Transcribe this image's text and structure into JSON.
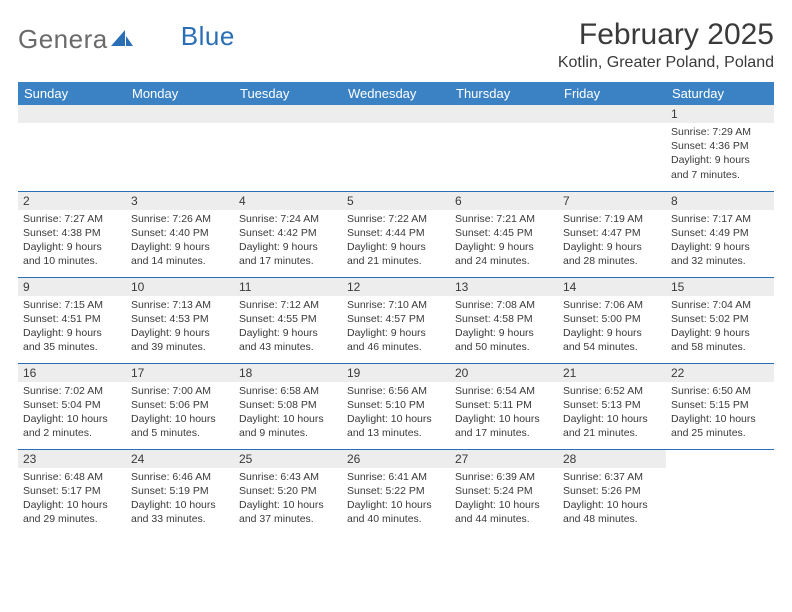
{
  "brand": {
    "part1": "Genera",
    "part2": "Blue"
  },
  "title": "February 2025",
  "location": "Kotlin, Greater Poland, Poland",
  "day_headers": [
    "Sunday",
    "Monday",
    "Tuesday",
    "Wednesday",
    "Thursday",
    "Friday",
    "Saturday"
  ],
  "weeks": [
    [
      null,
      null,
      null,
      null,
      null,
      null,
      {
        "n": "1",
        "sunrise": "7:29 AM",
        "sunset": "4:36 PM",
        "daylight": "9 hours and 7 minutes."
      }
    ],
    [
      {
        "n": "2",
        "sunrise": "7:27 AM",
        "sunset": "4:38 PM",
        "daylight": "9 hours and 10 minutes."
      },
      {
        "n": "3",
        "sunrise": "7:26 AM",
        "sunset": "4:40 PM",
        "daylight": "9 hours and 14 minutes."
      },
      {
        "n": "4",
        "sunrise": "7:24 AM",
        "sunset": "4:42 PM",
        "daylight": "9 hours and 17 minutes."
      },
      {
        "n": "5",
        "sunrise": "7:22 AM",
        "sunset": "4:44 PM",
        "daylight": "9 hours and 21 minutes."
      },
      {
        "n": "6",
        "sunrise": "7:21 AM",
        "sunset": "4:45 PM",
        "daylight": "9 hours and 24 minutes."
      },
      {
        "n": "7",
        "sunrise": "7:19 AM",
        "sunset": "4:47 PM",
        "daylight": "9 hours and 28 minutes."
      },
      {
        "n": "8",
        "sunrise": "7:17 AM",
        "sunset": "4:49 PM",
        "daylight": "9 hours and 32 minutes."
      }
    ],
    [
      {
        "n": "9",
        "sunrise": "7:15 AM",
        "sunset": "4:51 PM",
        "daylight": "9 hours and 35 minutes."
      },
      {
        "n": "10",
        "sunrise": "7:13 AM",
        "sunset": "4:53 PM",
        "daylight": "9 hours and 39 minutes."
      },
      {
        "n": "11",
        "sunrise": "7:12 AM",
        "sunset": "4:55 PM",
        "daylight": "9 hours and 43 minutes."
      },
      {
        "n": "12",
        "sunrise": "7:10 AM",
        "sunset": "4:57 PM",
        "daylight": "9 hours and 46 minutes."
      },
      {
        "n": "13",
        "sunrise": "7:08 AM",
        "sunset": "4:58 PM",
        "daylight": "9 hours and 50 minutes."
      },
      {
        "n": "14",
        "sunrise": "7:06 AM",
        "sunset": "5:00 PM",
        "daylight": "9 hours and 54 minutes."
      },
      {
        "n": "15",
        "sunrise": "7:04 AM",
        "sunset": "5:02 PM",
        "daylight": "9 hours and 58 minutes."
      }
    ],
    [
      {
        "n": "16",
        "sunrise": "7:02 AM",
        "sunset": "5:04 PM",
        "daylight": "10 hours and 2 minutes."
      },
      {
        "n": "17",
        "sunrise": "7:00 AM",
        "sunset": "5:06 PM",
        "daylight": "10 hours and 5 minutes."
      },
      {
        "n": "18",
        "sunrise": "6:58 AM",
        "sunset": "5:08 PM",
        "daylight": "10 hours and 9 minutes."
      },
      {
        "n": "19",
        "sunrise": "6:56 AM",
        "sunset": "5:10 PM",
        "daylight": "10 hours and 13 minutes."
      },
      {
        "n": "20",
        "sunrise": "6:54 AM",
        "sunset": "5:11 PM",
        "daylight": "10 hours and 17 minutes."
      },
      {
        "n": "21",
        "sunrise": "6:52 AM",
        "sunset": "5:13 PM",
        "daylight": "10 hours and 21 minutes."
      },
      {
        "n": "22",
        "sunrise": "6:50 AM",
        "sunset": "5:15 PM",
        "daylight": "10 hours and 25 minutes."
      }
    ],
    [
      {
        "n": "23",
        "sunrise": "6:48 AM",
        "sunset": "5:17 PM",
        "daylight": "10 hours and 29 minutes."
      },
      {
        "n": "24",
        "sunrise": "6:46 AM",
        "sunset": "5:19 PM",
        "daylight": "10 hours and 33 minutes."
      },
      {
        "n": "25",
        "sunrise": "6:43 AM",
        "sunset": "5:20 PM",
        "daylight": "10 hours and 37 minutes."
      },
      {
        "n": "26",
        "sunrise": "6:41 AM",
        "sunset": "5:22 PM",
        "daylight": "10 hours and 40 minutes."
      },
      {
        "n": "27",
        "sunrise": "6:39 AM",
        "sunset": "5:24 PM",
        "daylight": "10 hours and 44 minutes."
      },
      {
        "n": "28",
        "sunrise": "6:37 AM",
        "sunset": "5:26 PM",
        "daylight": "10 hours and 48 minutes."
      },
      null
    ]
  ],
  "labels": {
    "sunrise": "Sunrise:",
    "sunset": "Sunset:",
    "daylight": "Daylight:"
  }
}
